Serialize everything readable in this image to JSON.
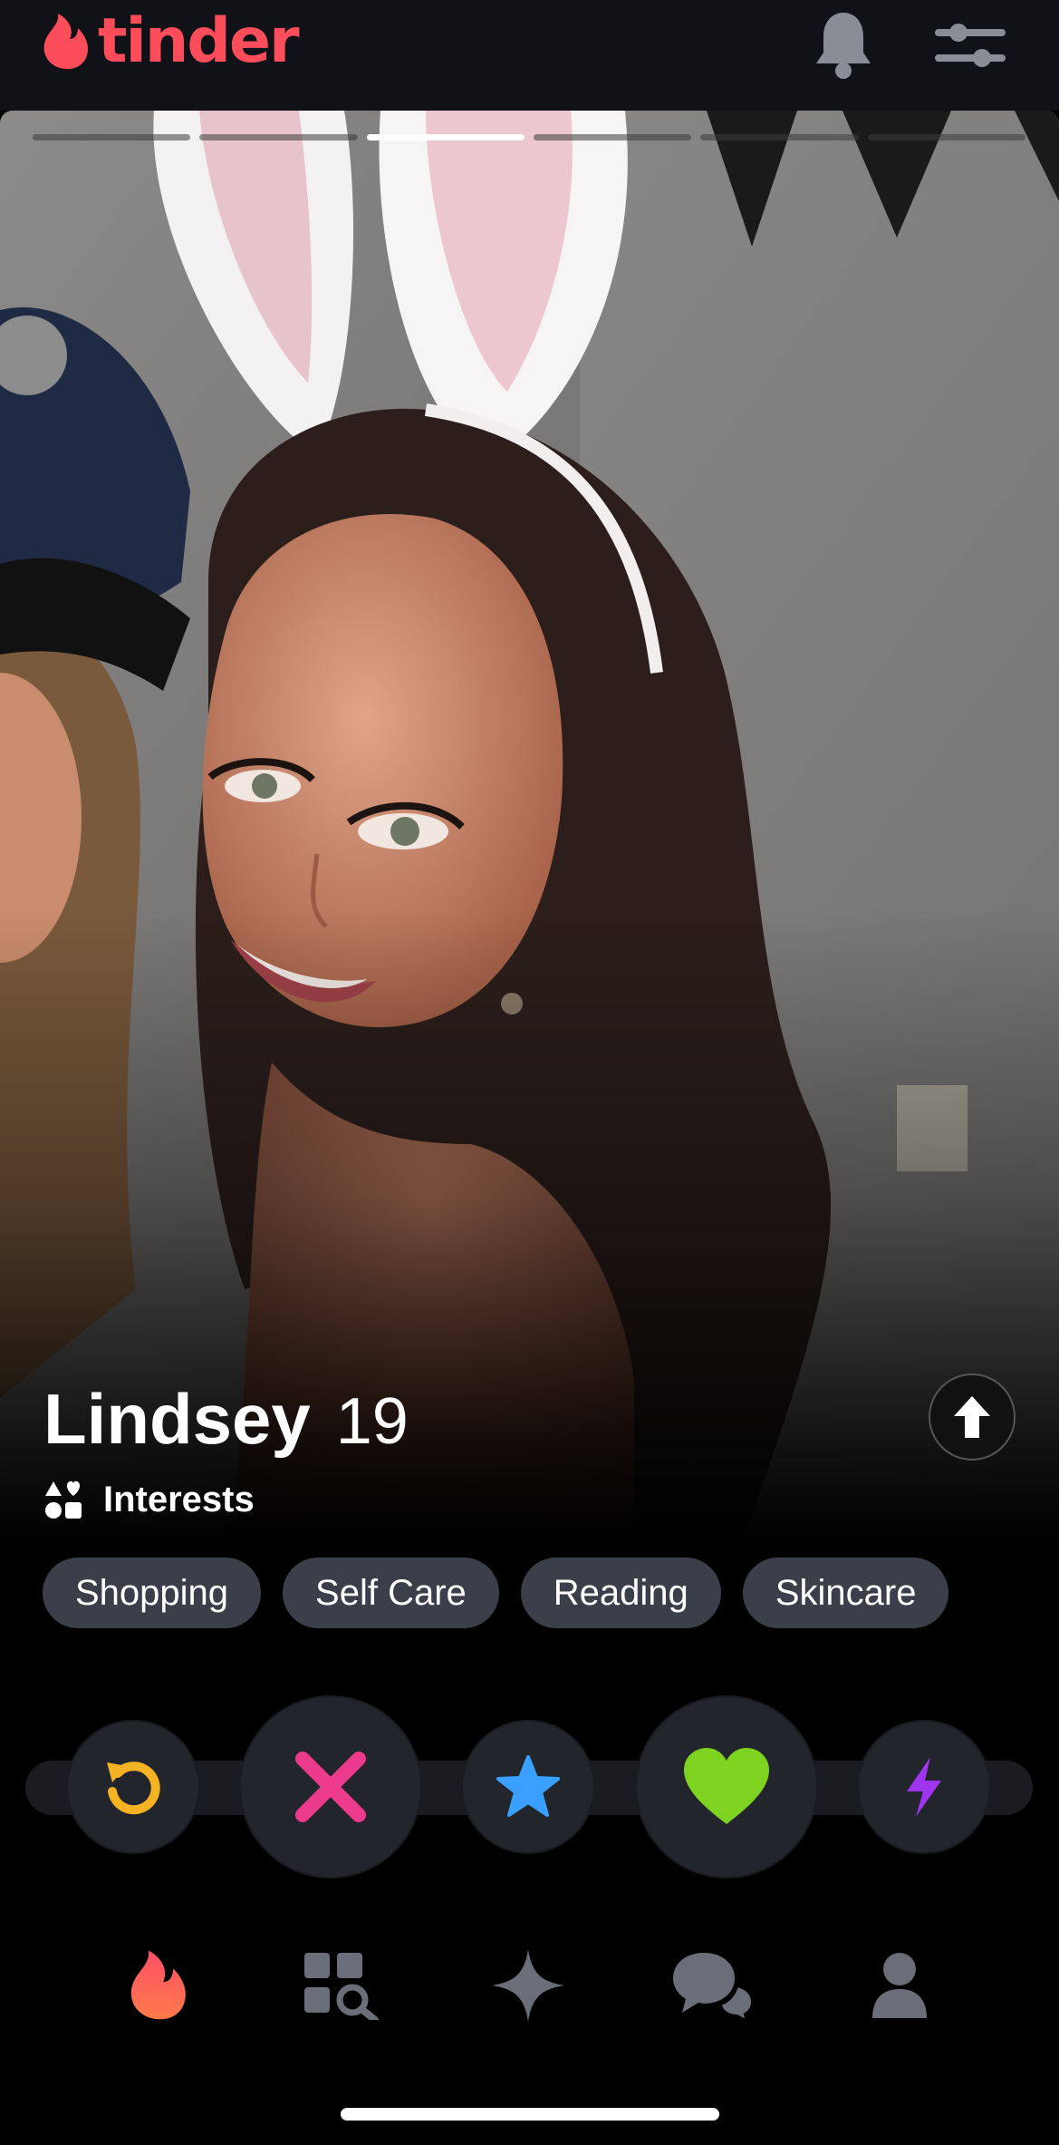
{
  "app": {
    "logo_text": "tinder",
    "brand_color": "#fd4d5b"
  },
  "header": {
    "icons": [
      "bell-icon",
      "filter-sliders-icon"
    ]
  },
  "photo": {
    "total": 6,
    "current_index": 3
  },
  "profile": {
    "name": "Lindsey",
    "age": "19",
    "interests_label": "Interests",
    "interests": [
      "Shopping",
      "Self Care",
      "Reading",
      "Skincare"
    ]
  },
  "actions": [
    "rewind-icon",
    "nope-x-icon",
    "super-like-star-icon",
    "like-heart-icon",
    "boost-bolt-icon"
  ],
  "bottom_nav": [
    "flame-icon",
    "explore-grid-icon",
    "sparkle-icon",
    "chat-bubbles-icon",
    "profile-icon"
  ],
  "colors": {
    "rewind": "#f5b324",
    "nope": "#ec3a8c",
    "super_like": "#3aa0ff",
    "like": "#7ed321",
    "boost": "#a035ef",
    "background": "#000000",
    "chip": "#3b3f4a"
  }
}
